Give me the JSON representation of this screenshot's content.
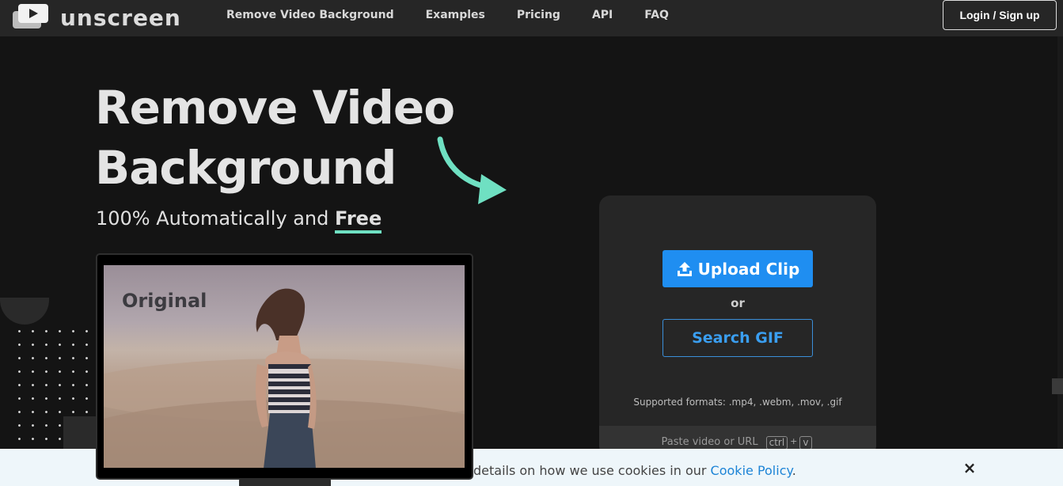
{
  "brand": {
    "name": "unscreen"
  },
  "nav": {
    "links": [
      "Remove Video Background",
      "Examples",
      "Pricing",
      "API",
      "FAQ"
    ],
    "login_label": "Login / Sign up"
  },
  "hero": {
    "title_line1": "Remove Video",
    "title_line2": "Background",
    "subtitle_prefix": "100% Automatically and ",
    "subtitle_highlight": "Free",
    "preview_label": "Original"
  },
  "upload": {
    "upload_label": "Upload Clip",
    "or_label": "or",
    "gif_label": "Search GIF",
    "formats": "Supported formats: .mp4, .webm, .mov, .gif",
    "paste_label": "Paste video or URL",
    "key_ctrl": "ctrl",
    "key_plus": "+",
    "key_v": "v"
  },
  "cookie": {
    "text": "details on how we use cookies in our ",
    "link": "Cookie Policy",
    "suffix": ".",
    "close": "×"
  },
  "colors": {
    "accent_blue": "#1f8ef1",
    "accent_mint": "#6fe0c2",
    "background": "#141414",
    "nav_bg": "#262626",
    "card_bg": "#262626"
  },
  "icons": [
    "video-logo-icon",
    "curved-arrow-icon",
    "upload-icon",
    "close-icon"
  ]
}
